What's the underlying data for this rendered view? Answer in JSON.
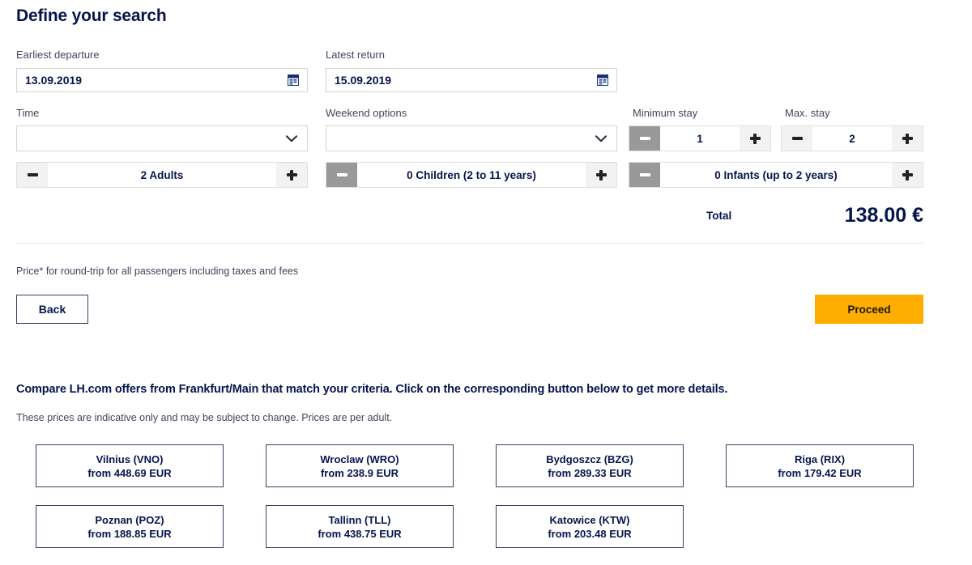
{
  "page": {
    "title": "Define your search"
  },
  "form": {
    "earliest_departure": {
      "label": "Earliest departure",
      "value": "13.09.2019",
      "icon": "calendar-icon"
    },
    "latest_return": {
      "label": "Latest return",
      "value": "15.09.2019",
      "icon": "calendar-icon"
    },
    "time": {
      "label": "Time",
      "value": "",
      "placeholder": "",
      "icon": "chevron-down-icon"
    },
    "weekend_options": {
      "label": "Weekend options",
      "value": "",
      "placeholder": "",
      "icon": "chevron-down-icon"
    },
    "minimum_stay": {
      "label": "Minimum stay",
      "value": "1",
      "minus_label": "−",
      "plus_label": "+",
      "minus_disabled": true
    },
    "max_stay": {
      "label": "Max. stay",
      "value": "2",
      "minus_label": "−",
      "plus_label": "+",
      "minus_disabled": false
    },
    "adults": {
      "value": "2 Adults",
      "minus_disabled": false
    },
    "children": {
      "value": "0 Children (2 to 11 years)",
      "minus_disabled": true
    },
    "infants": {
      "value": "0 Infants (up to 2 years)",
      "minus_disabled": true
    }
  },
  "total": {
    "label": "Total",
    "value": "138.00 €"
  },
  "notes": {
    "price_note": "Price* for round-trip for all passengers including taxes and fees"
  },
  "actions": {
    "back_label": "Back",
    "proceed_label": "Proceed"
  },
  "compare": {
    "heading": "Compare LH.com offers from Frankfurt/Main that match your criteria. Click on the corresponding button below to get more details.",
    "subheading": "These prices are indicative only and may be subject to change. Prices are per adult.",
    "destinations": [
      {
        "name": "Vilnius (VNO)",
        "price": "from 448.69 EUR"
      },
      {
        "name": "Wroclaw (WRO)",
        "price": "from 238.9 EUR"
      },
      {
        "name": "Bydgoszcz (BZG)",
        "price": "from 289.33 EUR"
      },
      {
        "name": "Riga (RIX)",
        "price": "from 179.42 EUR"
      },
      {
        "name": "Poznan (POZ)",
        "price": "from 188.85 EUR"
      },
      {
        "name": "Tallinn (TLL)",
        "price": "from 438.75 EUR"
      },
      {
        "name": "Katowice (KTW)",
        "price": "from 203.48 EUR"
      }
    ]
  },
  "colors": {
    "brand_navy": "#05164d",
    "accent_orange": "#ffad00",
    "disabled_gray": "#999999",
    "button_gray": "#f2f2f2",
    "border_gray": "#d4d4d4"
  }
}
